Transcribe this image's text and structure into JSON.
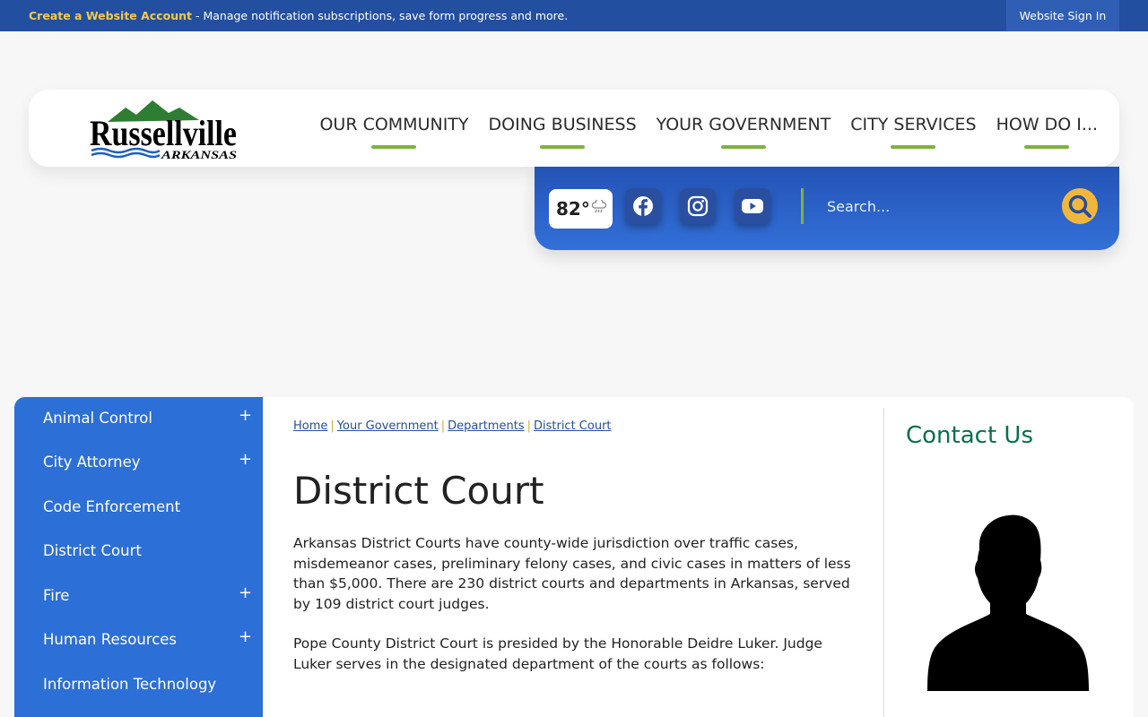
{
  "topbar": {
    "create_account": "Create a Website Account",
    "message": " - Manage notification subscriptions, save form progress and more.",
    "sign_in": "Website Sign In"
  },
  "logo": {
    "name": "Russellville",
    "sub": "ARKANSAS"
  },
  "nav": [
    "OUR COMMUNITY",
    "DOING BUSINESS",
    "YOUR GOVERNMENT",
    "CITY SERVICES",
    "HOW DO I..."
  ],
  "toolbar": {
    "temperature": "82°",
    "weather_icon": "rain-cloud-icon",
    "social": [
      "facebook-icon",
      "instagram-icon",
      "youtube-icon"
    ],
    "search_placeholder": "Search..."
  },
  "sidebar": {
    "items": [
      {
        "label": "Animal Control",
        "expandable": "+"
      },
      {
        "label": "City Attorney",
        "expandable": "+"
      },
      {
        "label": "Code Enforcement",
        "expandable": ""
      },
      {
        "label": "District Court",
        "expandable": ""
      },
      {
        "label": "Fire",
        "expandable": "+"
      },
      {
        "label": "Human Resources",
        "expandable": "+"
      },
      {
        "label": "Information Technology",
        "expandable": ""
      }
    ]
  },
  "breadcrumb": [
    "Home",
    "Your Government",
    "Departments",
    "District Court"
  ],
  "page": {
    "title": "District Court",
    "paragraphs": [
      "Arkansas District Courts have county-wide jurisdiction over traffic cases, misdemeanor cases, preliminary felony cases, and civic cases in matters of less than $5,000.  There are 230 district courts and departments in Arkansas, served by 109 district court judges.",
      "Pope County District Court is presided by the Honorable Deidre Luker.  Judge Luker serves in the designated department of the courts as follows:"
    ]
  },
  "contact": {
    "title": "Contact Us"
  },
  "colors": {
    "topbar": "#234fa1",
    "accent_green": "#7fb33b",
    "search_button": "#f2b73a",
    "sidebar": "#2c6fd6",
    "contact_title": "#0b6e4f"
  }
}
